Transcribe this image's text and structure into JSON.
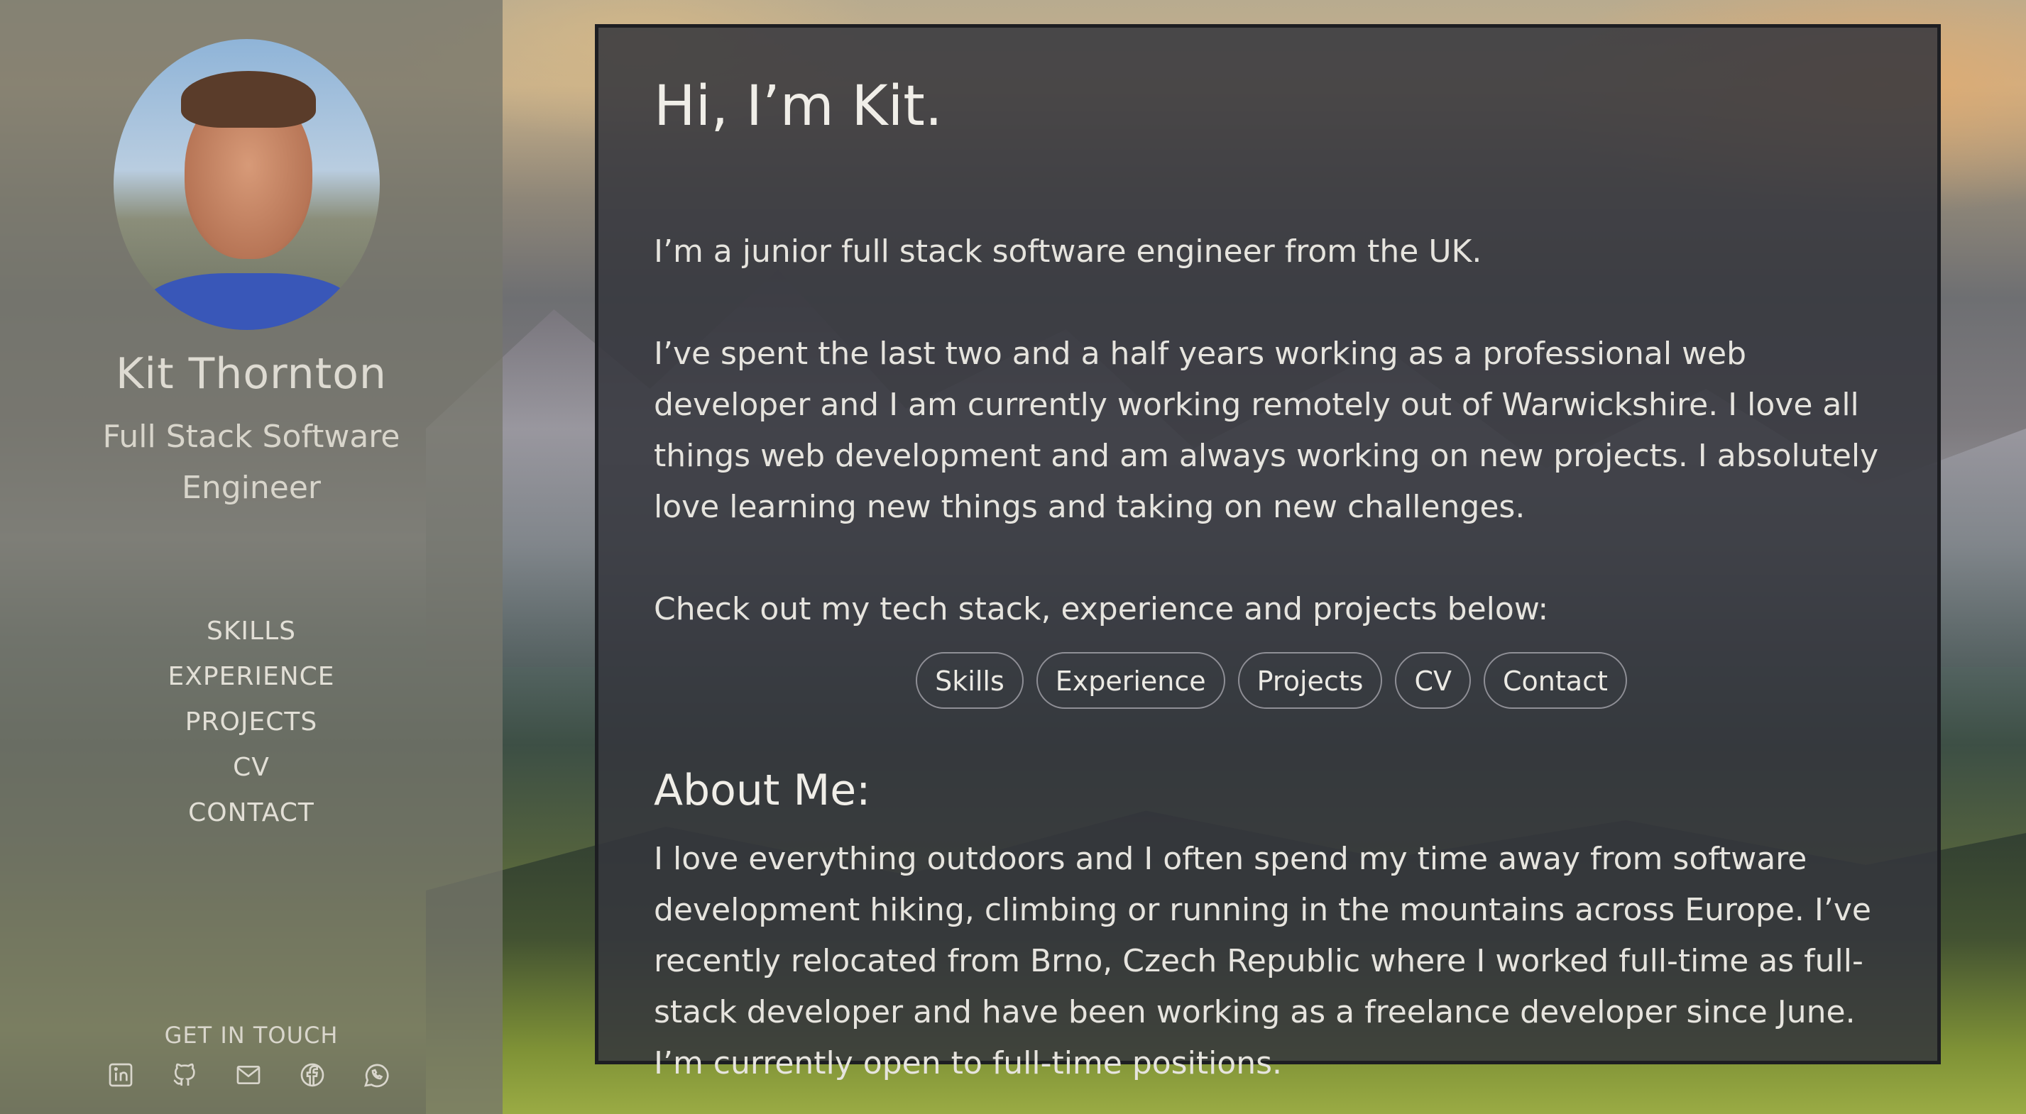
{
  "sidebar": {
    "name": "Kit Thornton",
    "title": "Full Stack Software Engineer",
    "nav": [
      "SKILLS",
      "EXPERIENCE",
      "PROJECTS",
      "CV",
      "CONTACT"
    ],
    "get_in_touch": "GET IN TOUCH",
    "socials": [
      "linkedin-icon",
      "github-icon",
      "mail-icon",
      "facebook-icon",
      "whatsapp-icon"
    ]
  },
  "main": {
    "greeting": "Hi, I’m Kit.",
    "intro": "I’m a junior full stack software engineer from the UK.",
    "experience": "I’ve spent the last two and a half years working as a professional web developer and I am currently working remotely out of Warwickshire. I love all things web development and am always working on new projects. I absolutely love learning new things and taking on new challenges.",
    "check_out": "Check out my tech stack, experience and projects below:",
    "buttons": [
      "Skills",
      "Experience",
      "Projects",
      "CV",
      "Contact"
    ],
    "about_heading": "About Me:",
    "about_text": "I love everything outdoors and I often spend my time away from software development hiking, climbing or running in the mountains across Europe. I’ve recently relocated from Brno, Czech Republic where I worked full-time as full-stack developer and have been working as a freelance developer since June. I’m currently open to full-time positions."
  },
  "colors": {
    "sidebar_overlay": "#76766c",
    "card_background": "#34353c",
    "card_border": "#1d1e22",
    "text_light": "#e8e6e0"
  }
}
